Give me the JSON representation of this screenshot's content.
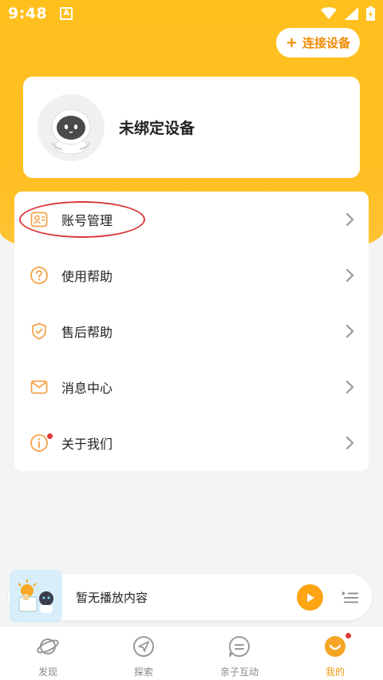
{
  "status_bar": {
    "time": "9:48",
    "notification_letter": "A"
  },
  "header": {
    "connect_button_plus": "+",
    "connect_button_label": "连接设备"
  },
  "device_card": {
    "name": "未绑定设备"
  },
  "menu": {
    "items": [
      {
        "label": "账号管理",
        "icon": "account-card-icon"
      },
      {
        "label": "使用帮助",
        "icon": "question-circle-icon"
      },
      {
        "label": "售后帮助",
        "icon": "shield-check-icon"
      },
      {
        "label": "消息中心",
        "icon": "mail-icon"
      },
      {
        "label": "关于我们",
        "icon": "info-circle-icon",
        "has_badge": true
      }
    ]
  },
  "player": {
    "status_text": "暂无播放内容"
  },
  "tabs": [
    {
      "label": "发现",
      "icon": "planet-icon",
      "active": false
    },
    {
      "label": "探索",
      "icon": "compass-send-icon",
      "active": false
    },
    {
      "label": "亲子互动",
      "icon": "chat-bubble-icon",
      "active": false
    },
    {
      "label": "我的",
      "icon": "smiley-face-icon",
      "active": true,
      "has_badge": true
    }
  ],
  "colors": {
    "accent": "#ffc01e",
    "accent_dark": "#f28a00",
    "icon_orange": "#f5a34a",
    "highlight_red": "#d9383e",
    "badge_red": "#e53935"
  }
}
